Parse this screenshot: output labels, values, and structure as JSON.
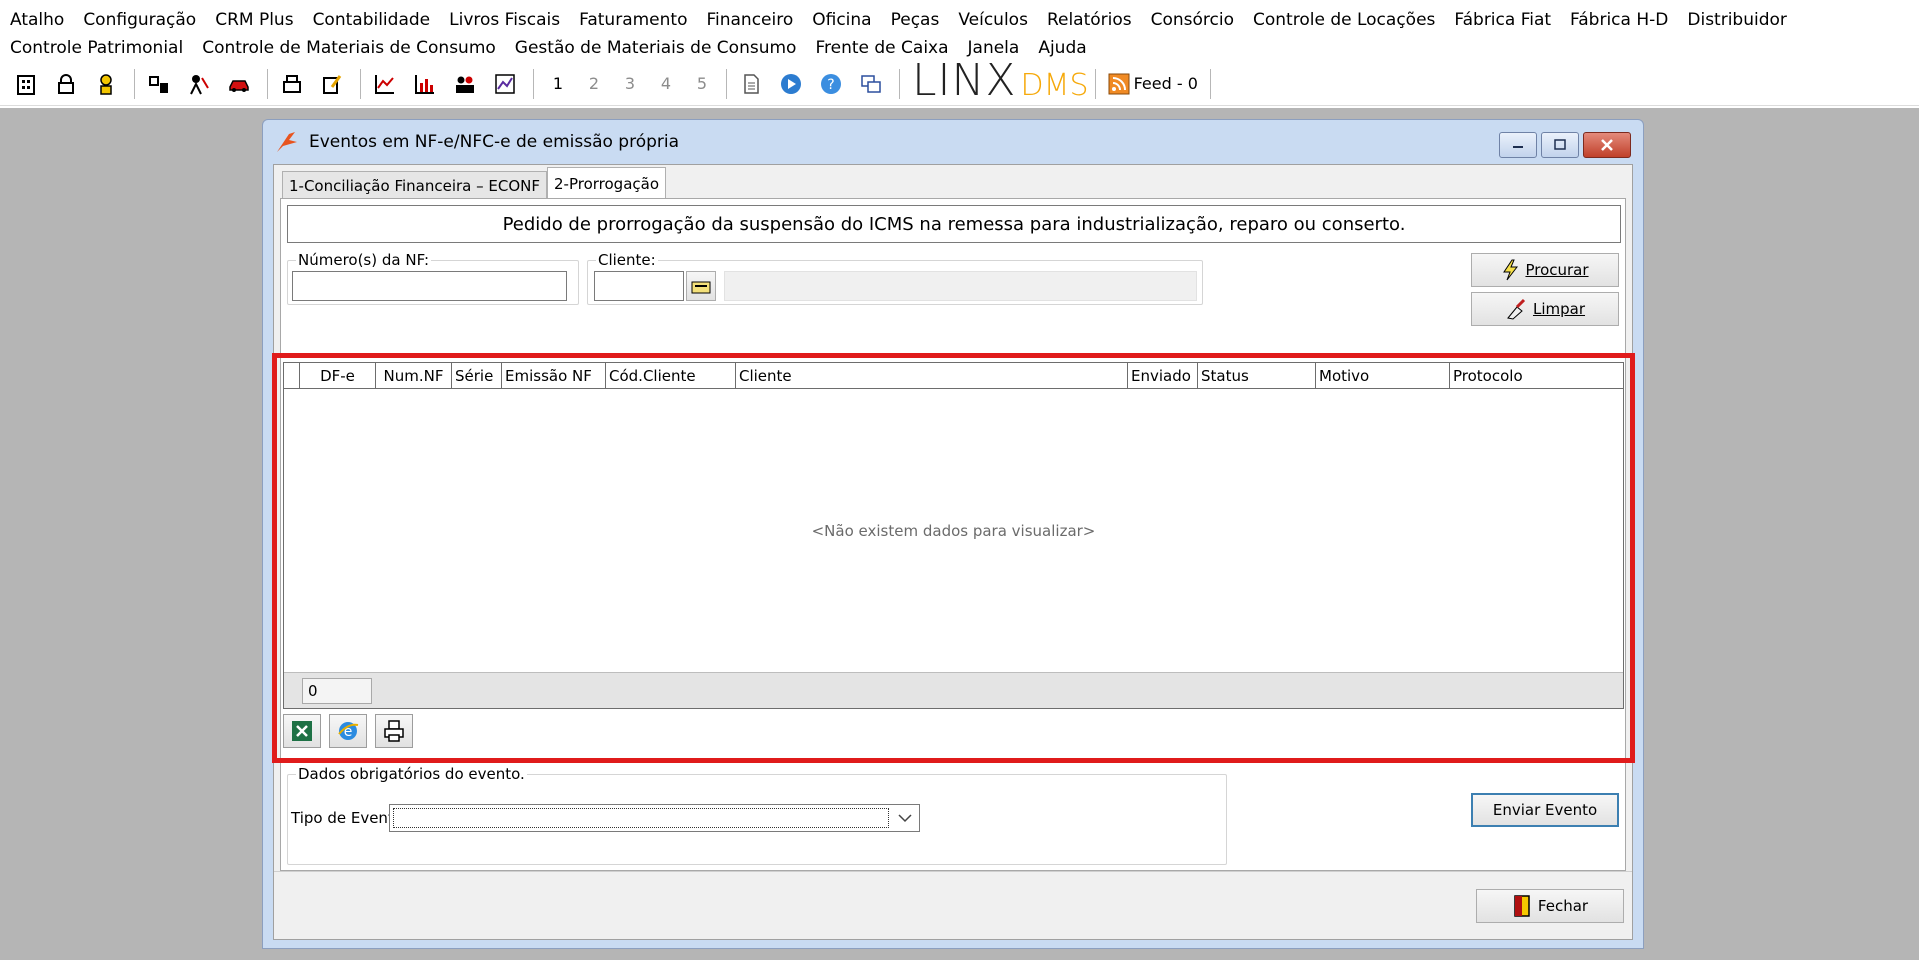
{
  "menubar": {
    "row1": [
      "Atalho",
      "Configuração",
      "CRM Plus",
      "Contabilidade",
      "Livros Fiscais",
      "Faturamento",
      "Financeiro",
      "Oficina",
      "Peças",
      "Veículos",
      "Relatórios",
      "Consórcio",
      "Controle de Locações",
      "Fábrica Fiat",
      "Fábrica H-D",
      "Distribuidor"
    ],
    "row2": [
      "Controle Patrimonial",
      "Controle de Materiais de Consumo",
      "Gestão de Materiais de Consumo",
      "Frente de Caixa",
      "Janela",
      "Ajuda"
    ]
  },
  "toolbar": {
    "pages": [
      "1",
      "2",
      "3",
      "4",
      "5"
    ],
    "logo_text": "LINX",
    "logo_suffix": "DMS",
    "feed_label": "Feed - 0"
  },
  "window": {
    "title": "Eventos em NF-e/NFC-e de emissão própria",
    "tabs": [
      {
        "label": "1-Conciliação Financeira – ECONF"
      },
      {
        "label": "2-Prorrogação"
      }
    ],
    "banner": "Pedido de prorrogação da suspensão do ICMS na remessa para industrialização, reparo ou conserto.",
    "filters": {
      "nf_label": "Número(s) da NF:",
      "nf_value": "",
      "cliente_label": "Cliente:",
      "cliente_value": ""
    },
    "buttons": {
      "procurar": "Procurar",
      "limpar": "Limpar",
      "enviar": "Enviar Evento",
      "fechar": "Fechar"
    },
    "grid": {
      "columns": [
        "DF-e",
        "Num.NF",
        "Série",
        "Emissão NF",
        "Cód.Cliente",
        "Cliente",
        "Enviado",
        "Status",
        "Motivo",
        "Protocolo"
      ],
      "empty_text": "<Não existem dados para visualizar>",
      "count": "0"
    },
    "evento": {
      "group_label": "Dados obrigatórios do evento.",
      "tipo_label": "Tipo de Evento:",
      "tipo_value": ""
    }
  },
  "colors": {
    "highlight": "#e01b1b",
    "desktop": "#b5b5b5",
    "window_frame": "#c9dbf2"
  }
}
